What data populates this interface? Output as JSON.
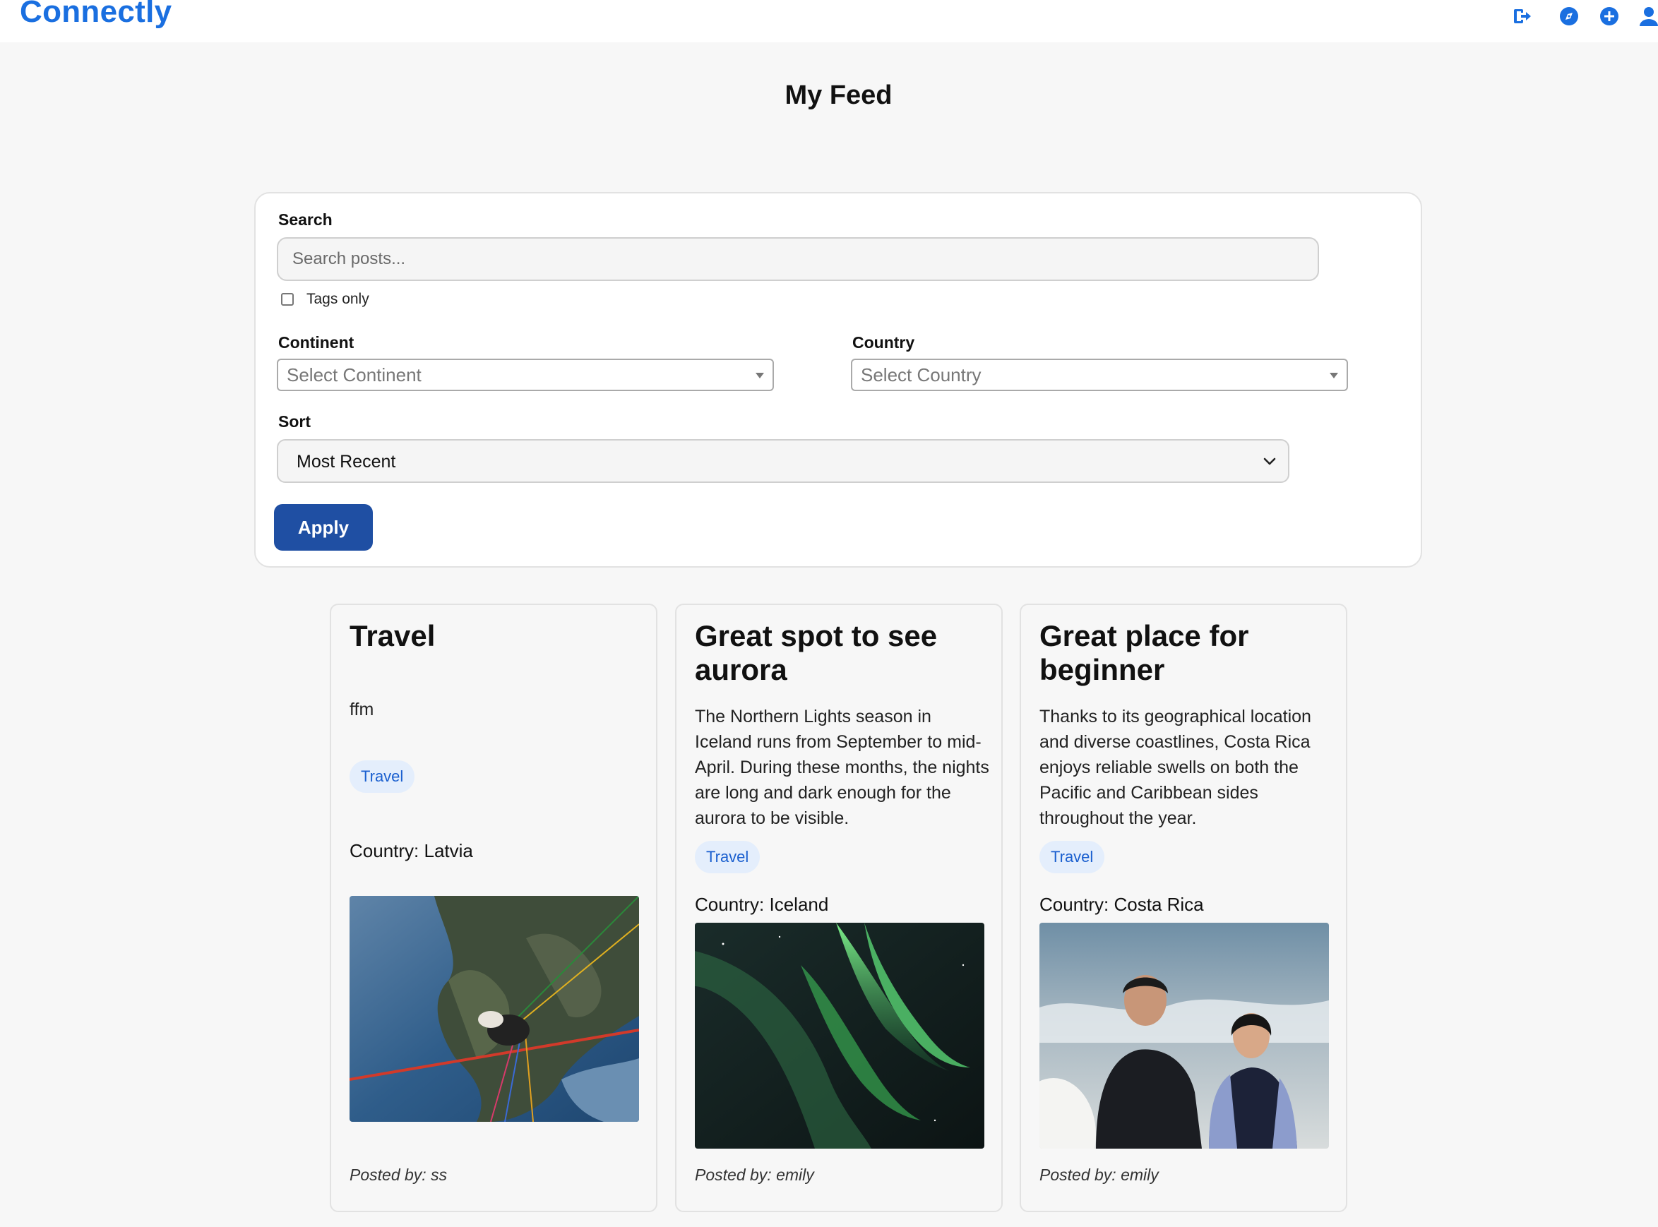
{
  "app": {
    "brand": "Connectly"
  },
  "header": {
    "icons": [
      "logout-icon",
      "compass-icon",
      "plus-circle-icon",
      "user-icon"
    ]
  },
  "page": {
    "title": "My Feed"
  },
  "filters": {
    "search_label": "Search",
    "search_placeholder": "Search posts...",
    "tags_only_label": "Tags only",
    "tags_only_checked": false,
    "continent_label": "Continent",
    "continent_placeholder": "Select Continent",
    "country_label": "Country",
    "country_placeholder": "Select Country",
    "sort_label": "Sort",
    "sort_value": "Most Recent",
    "apply_label": "Apply"
  },
  "posts": [
    {
      "title": "Travel",
      "body": "ffm",
      "tag": "Travel",
      "country": "Country: Latvia",
      "image": "paragliding-photo",
      "posted_by": "Posted by: ss"
    },
    {
      "title": "Great spot to see aurora",
      "body": "The Northern Lights season in Iceland runs from September to mid-April. During these months, the nights are long and dark enough for the aurora to be visible.",
      "tag": "Travel",
      "country": "Country: Iceland",
      "image": "aurora-photo",
      "posted_by": "Posted by: emily"
    },
    {
      "title": "Great place for beginner",
      "body": "Thanks to its geographical location and diverse coastlines, Costa Rica enjoys reliable swells on both the Pacific and Caribbean sides throughout the year.",
      "tag": "Travel",
      "country": "Country: Costa Rica",
      "image": "surfers-photo",
      "posted_by": "Posted by: emily"
    }
  ],
  "colors": {
    "brand": "#1a6fe0",
    "apply_button": "#1f4fa3",
    "tag_bg": "#e4eefc",
    "tag_text": "#1a5fcf"
  }
}
